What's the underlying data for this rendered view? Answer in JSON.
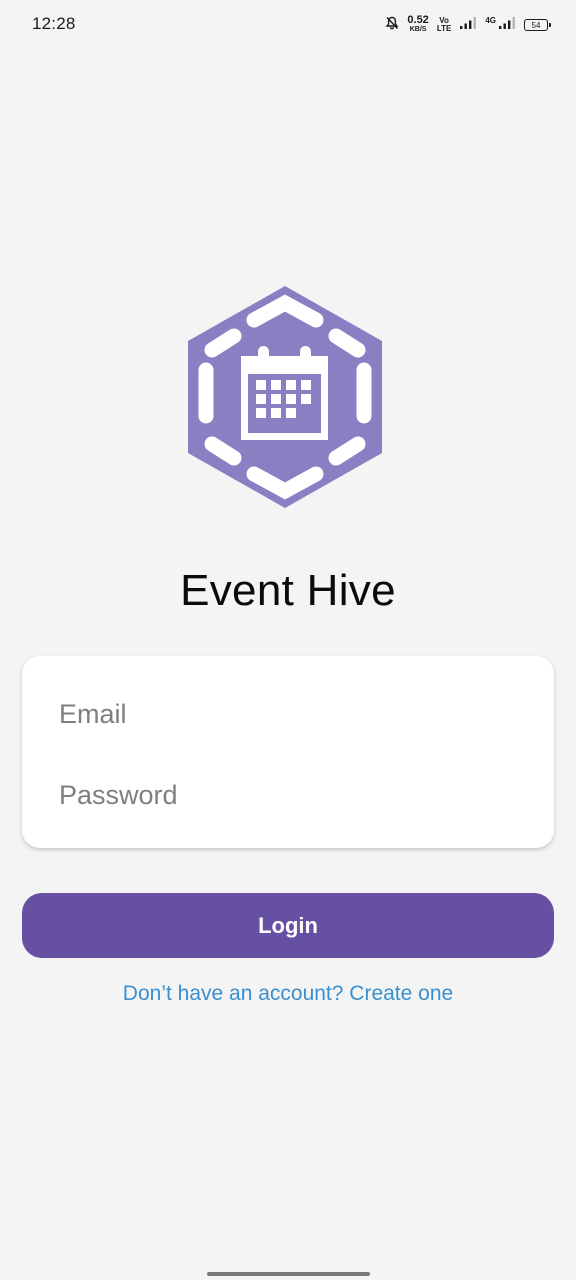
{
  "status_bar": {
    "time": "12:28",
    "net_speed_value": "0.52",
    "net_speed_unit": "KB/S",
    "volte_top": "Vo",
    "volte_bottom": "LTE",
    "network_type": "4G",
    "battery_level": "54",
    "icons": [
      "mute-bell-icon",
      "signal-icon",
      "signal-4g-icon",
      "battery-icon"
    ]
  },
  "app": {
    "title": "Event Hive",
    "logo_icon": "calendar-hive-icon",
    "brand_color": "#8a7fc2"
  },
  "form": {
    "email_placeholder": "Email",
    "email_value": "",
    "password_placeholder": "Password",
    "password_value": ""
  },
  "actions": {
    "login_label": "Login",
    "login_color": "#6650a4",
    "signup_link": "Don’t have an account? Create one",
    "link_color": "#3a8fd0"
  }
}
